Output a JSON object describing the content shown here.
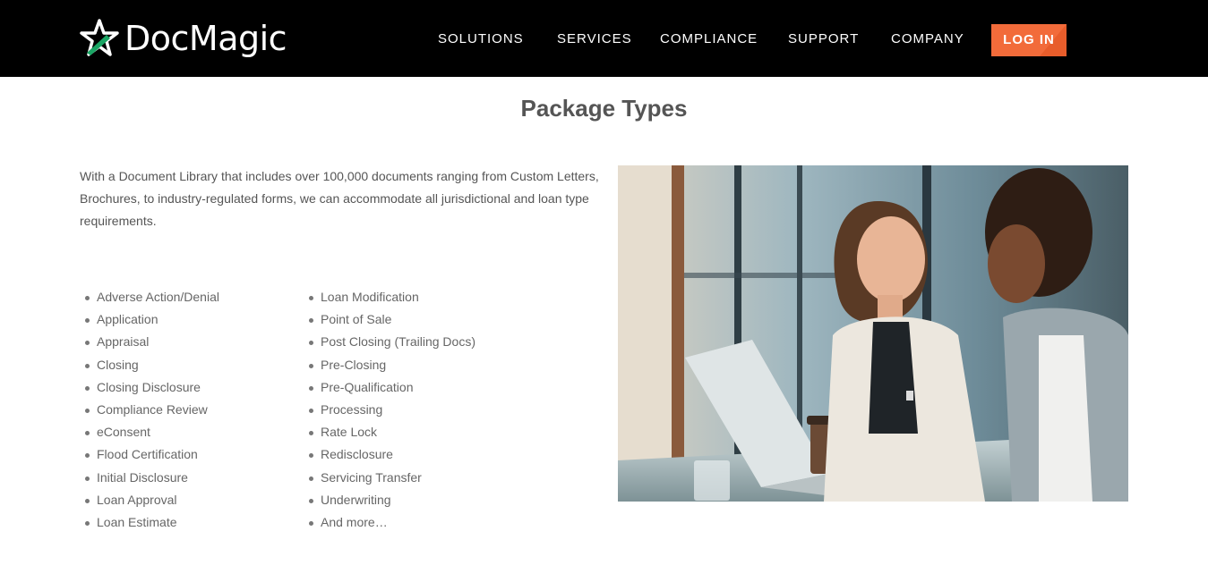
{
  "header": {
    "logo_text": "DocMagic",
    "nav": [
      {
        "label": "SOLUTIONS"
      },
      {
        "label": "SERVICES"
      },
      {
        "label": "COMPLIANCE"
      },
      {
        "label": "SUPPORT"
      },
      {
        "label": "COMPANY"
      }
    ],
    "login_label": "LOG IN"
  },
  "main": {
    "title": "Package Types",
    "intro": "With a Document Library that includes over 100,000 documents ranging from Custom Letters, Brochures, to industry-regulated forms, we can accommodate all jurisdictional and loan type requirements.",
    "list_left": [
      "Adverse Action/Denial",
      "Application",
      "Appraisal",
      "Closing",
      "Closing Disclosure",
      "Compliance Review",
      "eConsent",
      "Flood Certification",
      "Initial Disclosure",
      "Loan Approval",
      "Loan Estimate"
    ],
    "list_right": [
      "Loan Modification",
      "Point of Sale",
      "Post Closing (Trailing Docs)",
      "Pre-Closing",
      "Pre-Qualification",
      "Processing",
      "Rate Lock",
      "Redisclosure",
      "Servicing Transfer",
      "Underwriting",
      "And more…"
    ]
  },
  "colors": {
    "header_bg": "#000000",
    "accent": "#f26b3a",
    "logo_green": "#1aa564",
    "text": "#555555"
  }
}
